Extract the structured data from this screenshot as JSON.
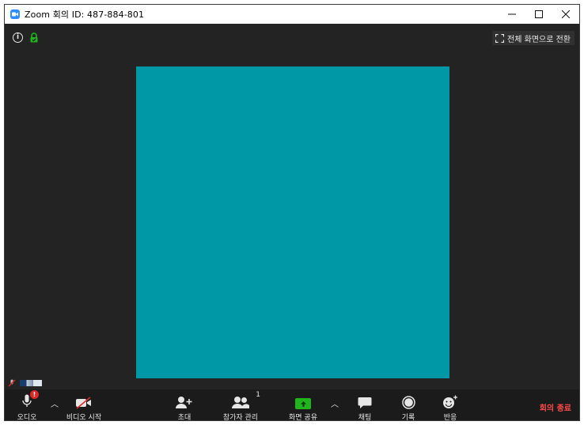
{
  "window": {
    "title": "Zoom 회의 ID: 487-884-801",
    "controls": {
      "minimize": "—",
      "maximize": "☐",
      "close": "✕"
    }
  },
  "meeting": {
    "fullscreen_label": "전체 화면으로 전환",
    "video_tile_color": "#0097a7"
  },
  "toolbar": {
    "audio": {
      "label": "오디오",
      "badge": "!"
    },
    "video": {
      "label": "비디오 시작"
    },
    "invite": {
      "label": "초대"
    },
    "participants": {
      "label": "참가자 관리",
      "count": "1"
    },
    "share": {
      "label": "화면 공유"
    },
    "chat": {
      "label": "채팅"
    },
    "record": {
      "label": "기록"
    },
    "reactions": {
      "label": "반응"
    },
    "end": {
      "label": "회의 종료",
      "color": "#ff4a4a"
    }
  },
  "colors": {
    "accent_blue": "#2d8cff",
    "share_green": "#22b41d",
    "alert_red": "#e02828"
  }
}
